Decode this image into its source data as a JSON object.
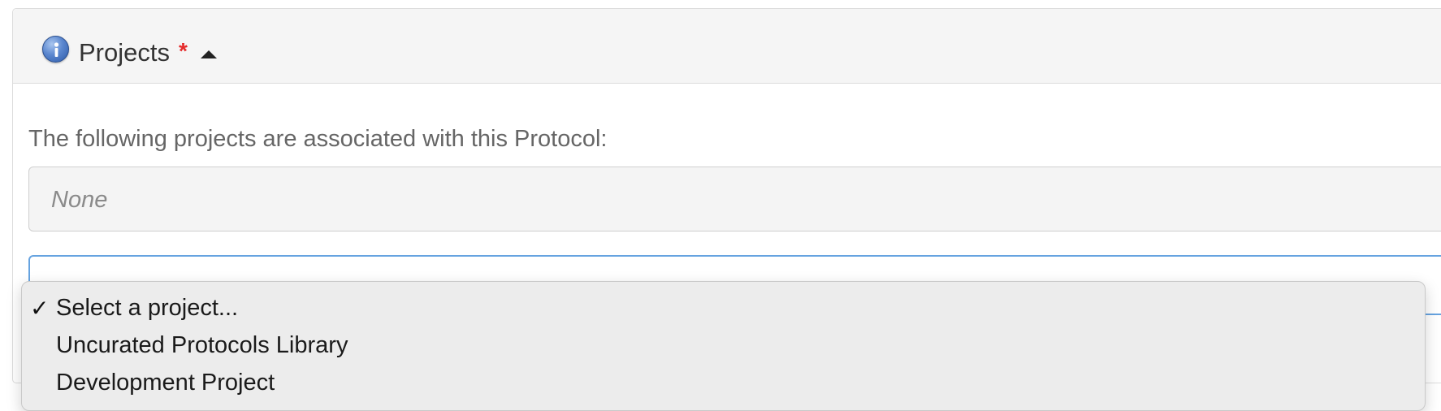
{
  "panel": {
    "title": "Projects",
    "required_marker": "*",
    "description": "The following projects are associated with this Protocol:",
    "associated_value": "None"
  },
  "icons": {
    "info": "info-icon",
    "toggle": "caret-up-icon",
    "selected": "checkmark-icon"
  },
  "dropdown": {
    "check_mark": "✓",
    "options": [
      {
        "label": "Select a project...",
        "selected": true
      },
      {
        "label": "Uncurated Protocols Library",
        "selected": false
      },
      {
        "label": "Development Project",
        "selected": false
      }
    ]
  },
  "colors": {
    "required": "#e52b2b",
    "focus_border": "#66a3e0",
    "info_icon": "#3a6bc1"
  }
}
